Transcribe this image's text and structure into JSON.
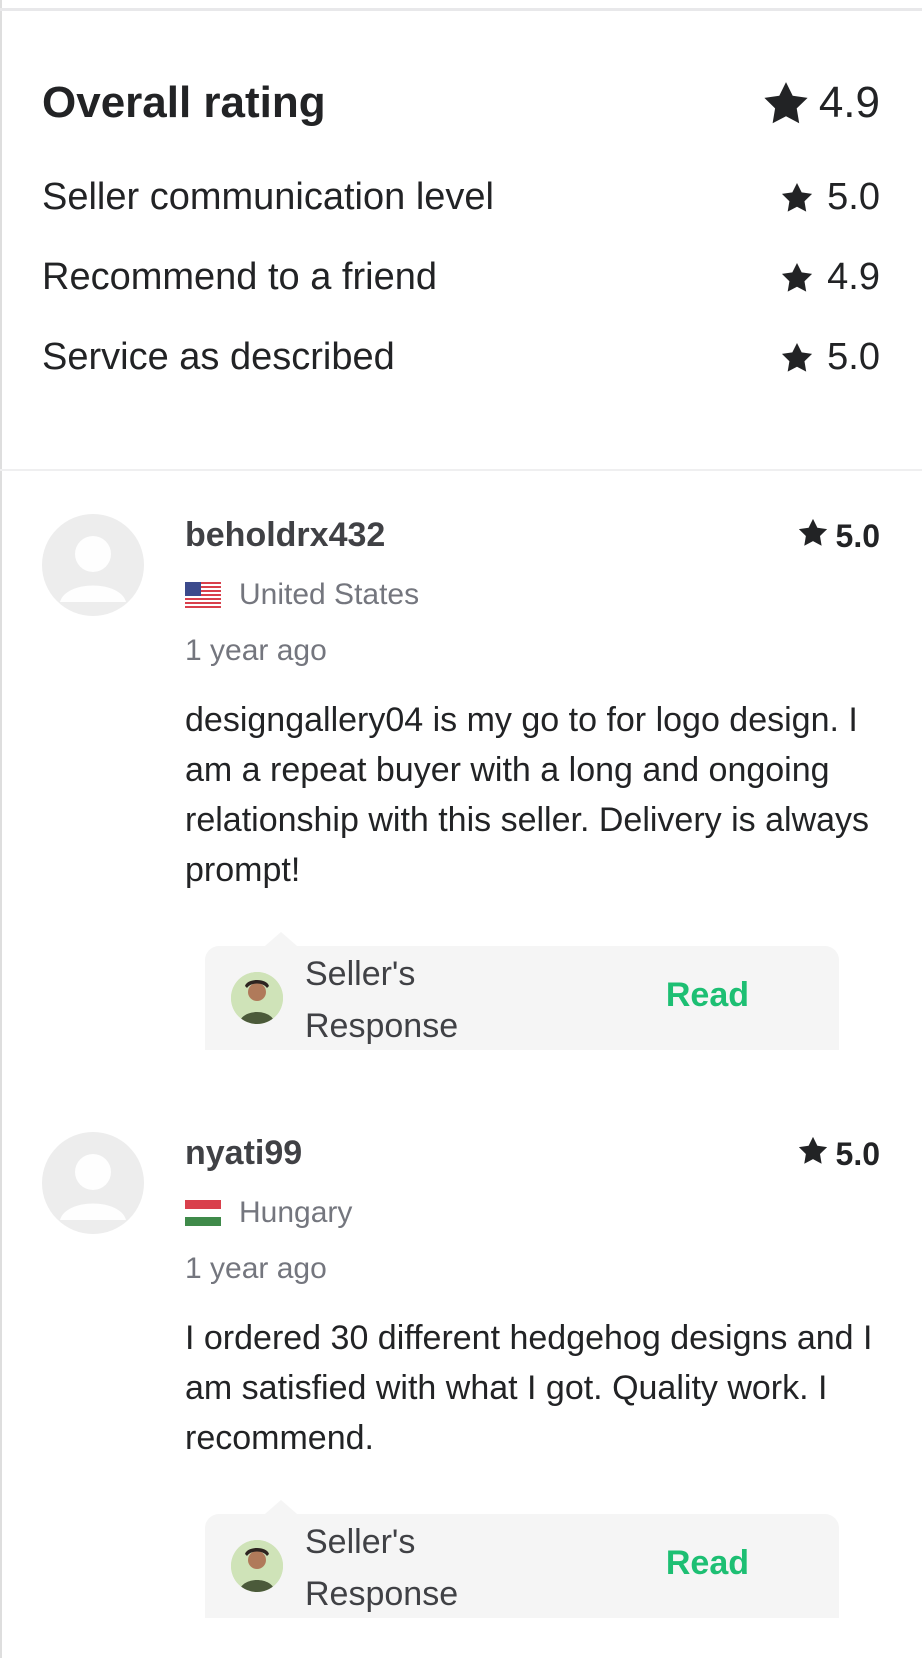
{
  "summary": {
    "overall": {
      "label": "Overall rating",
      "value": "4.9"
    },
    "items": [
      {
        "label": "Seller communication level",
        "value": "5.0"
      },
      {
        "label": "Recommend to a friend",
        "value": "4.9"
      },
      {
        "label": "Service as described",
        "value": "5.0"
      }
    ]
  },
  "reviews": [
    {
      "username": "beholdrx432",
      "rating": "5.0",
      "country": "United States",
      "flag_icon": "us-flag-icon",
      "time": "1 year ago",
      "text": "designgallery04 is my go to for logo design. I am a repeat buyer with a long and ongoing relationship with this seller. Delivery is always prompt!",
      "response": {
        "label": "Seller's Response",
        "action": "Read"
      }
    },
    {
      "username": "nyati99",
      "rating": "5.0",
      "country": "Hungary",
      "flag_icon": "hungary-flag-icon",
      "time": "1 year ago",
      "text": "I ordered 30 different hedgehog designs and I am satisfied with what I got. Quality work. I recommend.",
      "response": {
        "label": "Seller's Response",
        "action": "Read"
      }
    }
  ],
  "colors": {
    "text": "#222325",
    "muted": "#74767e",
    "accent": "#1dbf73",
    "response_bg": "#f5f5f5",
    "avatar_bg": "#ededed"
  }
}
